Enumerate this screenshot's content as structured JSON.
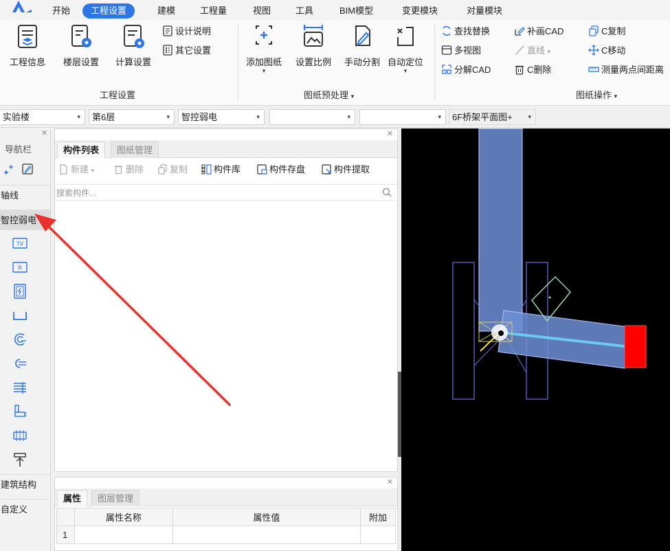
{
  "menu": {
    "items": [
      "开始",
      "工程设置",
      "建模",
      "工程量",
      "视图",
      "工具",
      "BIM模型",
      "变更模块",
      "对量模块"
    ],
    "active": "工程设置"
  },
  "ribbon": {
    "project_group": {
      "label": "工程设置",
      "project_info": "工程信息",
      "floor_settings": "楼层设置",
      "calc_settings": "计算设置",
      "design_notes": "设计说明",
      "other_settings": "其它设置"
    },
    "drawing_pre": {
      "label": "图纸预处理",
      "add_drawing": "添加图纸",
      "set_scale": "设置比例",
      "manual_split": "手动分割",
      "auto_locate": "自动定位"
    },
    "drawing_ops": {
      "label": "图纸操作",
      "find_replace": "查找替换",
      "supplement_cad": "补画CAD",
      "c_copy": "C复制",
      "multi_view": "多视图",
      "straight_line": "直线",
      "c_move": "C移动",
      "explode_cad": "分解CAD",
      "c_delete": "C删除",
      "measure_distance": "测量两点间距离"
    }
  },
  "selectors": {
    "building": "实验楼",
    "floor": "第6层",
    "discipline": "智控弱电",
    "empty1": "",
    "empty2": "",
    "drawing": "6F桥架平面图+"
  },
  "nav": {
    "title": "导航栏",
    "sections": [
      "轴线",
      "智控弱电",
      "建筑结构",
      "自定义"
    ],
    "active_section": "智控弱电",
    "icons": [
      "tv-outlet-icon",
      "r-outlet-icon",
      "power-panel-icon",
      "cable-tray-icon",
      "conduit-icon",
      "connector-icon",
      "wiring-icon",
      "pipe-fitting-icon",
      "terminal-block-icon",
      "pole-icon"
    ],
    "tv_label": "TV",
    "r_label": "R"
  },
  "component_list": {
    "tabs": [
      "构件列表",
      "图纸管理"
    ],
    "active_tab": "构件列表",
    "toolbar": {
      "new": "新建",
      "delete": "删除",
      "copy": "复制",
      "library": "构件库",
      "save": "构件存盘",
      "extract": "构件提取"
    },
    "search_placeholder": "搜索构件..."
  },
  "properties": {
    "tabs": [
      "属性",
      "图层管理"
    ],
    "active_tab": "属性",
    "columns": [
      "属性名称",
      "属性值",
      "附加"
    ],
    "rows": [
      {
        "index": "1",
        "name": "",
        "value": "",
        "extra": ""
      }
    ]
  },
  "colors": {
    "accent": "#2e76e6",
    "annotation_arrow": "#e8322b",
    "canvas_bg": "#000000",
    "tray_fill": "#6d8fd6",
    "end_marker": "#ff0000"
  }
}
